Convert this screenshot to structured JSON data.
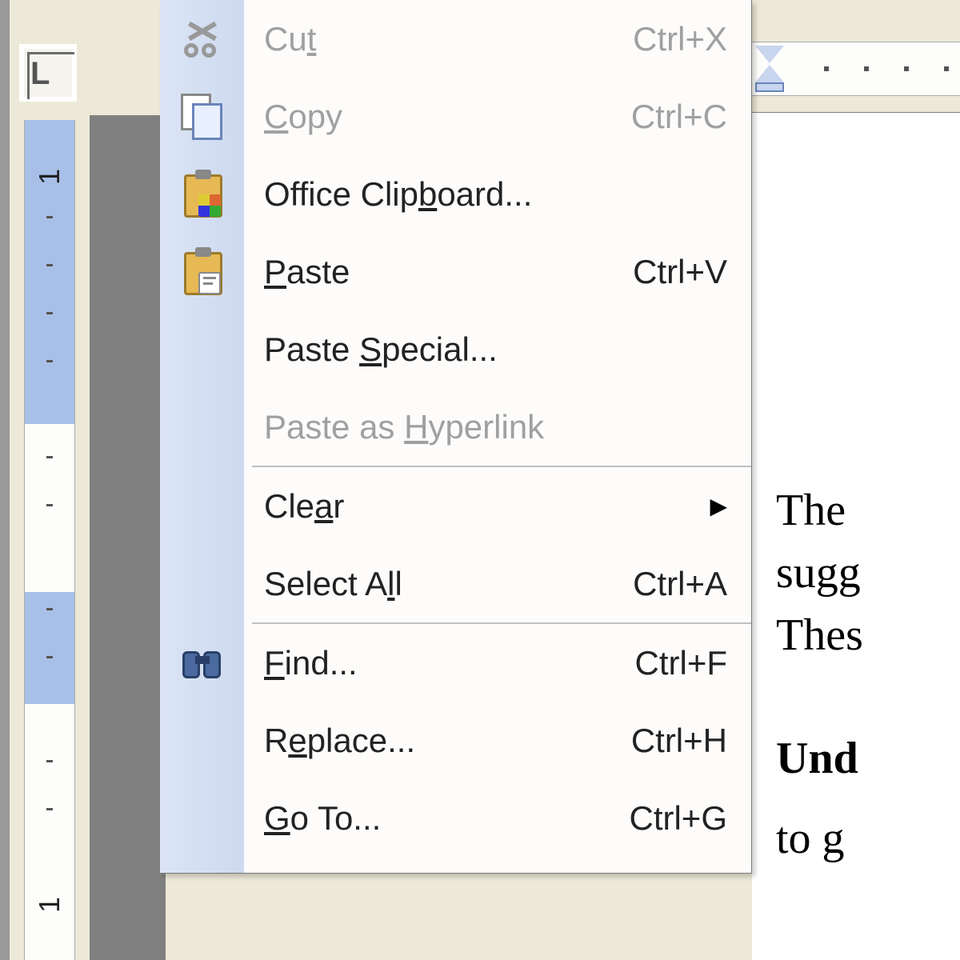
{
  "ruler": {
    "vnum1": "1",
    "vnum2": "1"
  },
  "menu": {
    "items": [
      {
        "label": "Cut",
        "underline_index": 2,
        "shortcut": "Ctrl+X",
        "icon": "scissors-icon",
        "disabled": true
      },
      {
        "label": "Copy",
        "underline_index": 0,
        "shortcut": "Ctrl+C",
        "icon": "copy-icon",
        "disabled": true
      },
      {
        "label": "Office Clipboard...",
        "underline_index": 11,
        "shortcut": "",
        "icon": "clipboard-office-icon",
        "disabled": false
      },
      {
        "label": "Paste",
        "underline_index": 0,
        "shortcut": "Ctrl+V",
        "icon": "clipboard-paste-icon",
        "disabled": false
      },
      {
        "label": "Paste Special...",
        "underline_index": 6,
        "shortcut": "",
        "icon": "",
        "disabled": false
      },
      {
        "label": "Paste as Hyperlink",
        "underline_index": 9,
        "shortcut": "",
        "icon": "",
        "disabled": true
      },
      {
        "sep": true
      },
      {
        "label": "Clear",
        "underline_index": 3,
        "shortcut": "",
        "icon": "",
        "disabled": false,
        "submenu": true
      },
      {
        "label": "Select All",
        "underline_index": 8,
        "shortcut": "Ctrl+A",
        "icon": "",
        "disabled": false
      },
      {
        "sep": true
      },
      {
        "label": "Find...",
        "underline_index": 0,
        "shortcut": "Ctrl+F",
        "icon": "binoculars-icon",
        "disabled": false
      },
      {
        "label": "Replace...",
        "underline_index": 1,
        "shortcut": "Ctrl+H",
        "icon": "",
        "disabled": false
      },
      {
        "label": "Go To...",
        "underline_index": 0,
        "shortcut": "Ctrl+G",
        "icon": "",
        "disabled": false
      }
    ]
  },
  "doc": {
    "line1": "The",
    "line2": "sugg",
    "line3": "Thes",
    "line4": "Und",
    "line5": "to g"
  }
}
